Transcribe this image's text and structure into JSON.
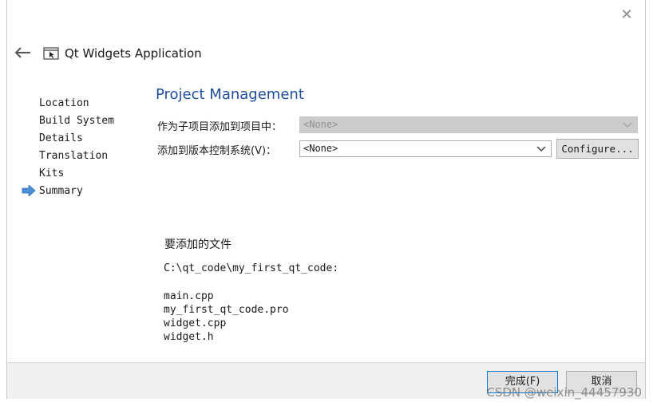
{
  "header": {
    "title": "Qt Widgets Application",
    "back_icon": "back-arrow-icon",
    "app_icon": "qt-widgets-app-icon",
    "close_glyph": "✕"
  },
  "sidebar": {
    "steps": [
      {
        "label": "Location"
      },
      {
        "label": "Build System"
      },
      {
        "label": "Details"
      },
      {
        "label": "Translation"
      },
      {
        "label": "Kits"
      },
      {
        "label": "Summary",
        "current": true
      }
    ],
    "current_indicator_color": "#4a8fd8"
  },
  "main": {
    "section_title": "Project Management",
    "add_as_subproject_label": "作为子项目添加到项目中：",
    "add_as_subproject_value": "<None>",
    "vcs_label": "添加到版本控制系统(V)：",
    "vcs_value": "<None>",
    "configure_label": "Configure...",
    "files_heading": "要添加的文件",
    "files_path": "C:\\qt_code\\my_first_qt_code:",
    "files": [
      "main.cpp",
      "my_first_qt_code.pro",
      "widget.cpp",
      "widget.h"
    ]
  },
  "footer": {
    "finish_label": "完成(F)",
    "cancel_label": "取消"
  },
  "watermark": "CSDN @weixin_44457930",
  "colors": {
    "title_blue": "#1f4e9e",
    "disabled_combo": "#cccccc",
    "footer_bg": "#f0f0f0"
  }
}
